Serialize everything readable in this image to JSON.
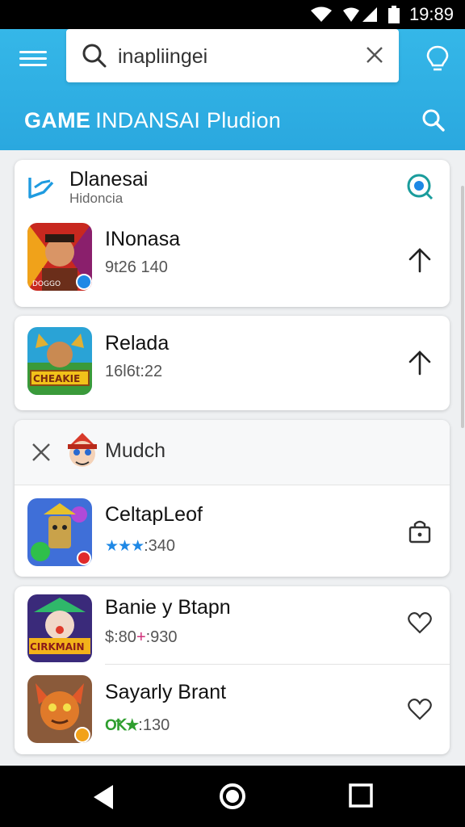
{
  "status_bar": {
    "time": "19:89"
  },
  "header": {
    "search_value": "inapliingei",
    "title_bold": "GAME",
    "title_rest": "INDANSAI Pludion"
  },
  "section": {
    "title": "Dlanesai",
    "subtitle": "Hidoncia"
  },
  "apps": [
    {
      "name": "INonasa",
      "meta": "9t26 140",
      "action_icon": "arrow-up-icon"
    },
    {
      "name": "Relada",
      "meta": "16l6t:22",
      "action_icon": "arrow-up-icon"
    },
    {
      "name": "CeltapLeof",
      "stars": "★★★",
      "meta": ":340",
      "action_icon": "lock-icon"
    },
    {
      "name": "Banie y Btapn",
      "meta": "$:80",
      "meta_plus": "+",
      "meta_rest": ":930",
      "action_icon": "heart-icon"
    },
    {
      "name": "Sayarly Brant",
      "stars": "OꝀ★",
      "meta": ":130",
      "action_icon": "heart-icon"
    }
  ],
  "dismiss_row": {
    "label": "Mudch"
  },
  "icon_texts": [
    "DOGGO",
    "CHEAKIE",
    "CIRKMAIN"
  ],
  "colors": {
    "header": "#2aa8df",
    "accent_blue": "#1e88e5",
    "accent_green": "#2e9e2e"
  }
}
